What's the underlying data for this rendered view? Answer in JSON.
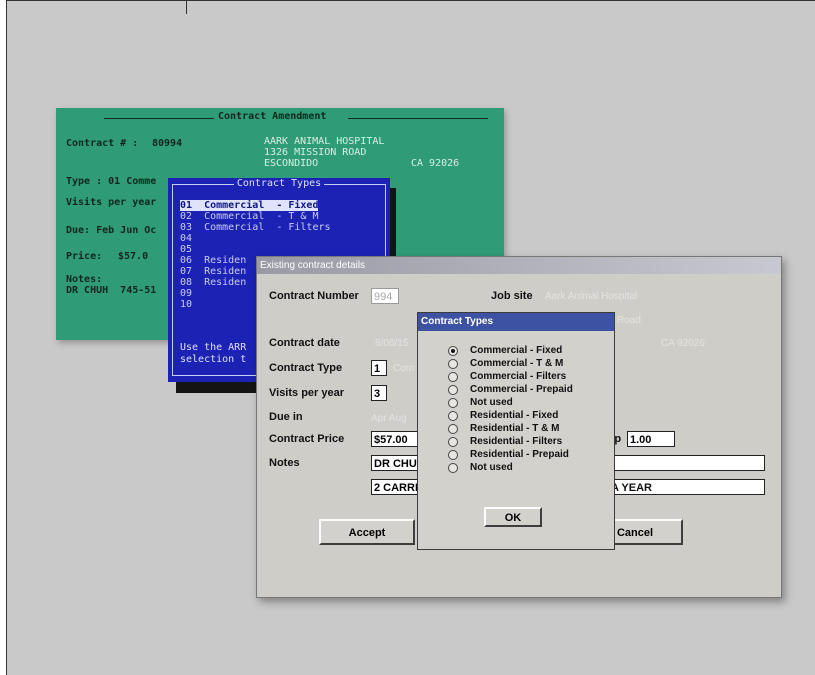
{
  "green_screen": {
    "title": "Contract Amendment",
    "contract_label": "Contract # :",
    "contract_number": "80994",
    "address1": "AARK ANIMAL HOSPITAL",
    "address2": "1326 MISSION ROAD",
    "city": "ESCONDIDO",
    "state_zip": "CA 92026",
    "type_label": "Type : 01 Comme",
    "visits_label": "Visits per year",
    "due_label": "Due: Feb Jun Oc",
    "price_label": "Price:",
    "price_value": "$57.0",
    "notes_label": "Notes:",
    "notes_value": "DR CHUH  745-51"
  },
  "blue_popup": {
    "title": "Contract Types",
    "rows": [
      "01  Commercial  - Fixed",
      "02  Commercial  - T & M",
      "03  Commercial  - Filters",
      "04",
      "05",
      "06  Residen",
      "07  Residen",
      "08  Residen",
      "09",
      "10"
    ],
    "hint1": "Use the ARR",
    "hint2": "selection t"
  },
  "dialog": {
    "title": "Existing contract details",
    "contract_number_label": "Contract Number",
    "contract_number_value": "994",
    "job_site_label": "Job site",
    "job_site_value": "Aark Animal Hospital",
    "road_value": "Road",
    "contract_date_label": "Contract date",
    "contract_date_value": "8/06/15",
    "state_zip_value": "CA  92026",
    "contract_type_label": "Contract Type",
    "contract_type_value": "1",
    "contract_type_ghost": "Com",
    "visits_label": "Visits per year",
    "visits_value": "3",
    "due_in_label": "Due in",
    "due_in_value": "Apr Aug",
    "contract_price_label": "Contract Price",
    "contract_price_value": "$57.00",
    "trip_label": "rip",
    "trip_value": "1.00",
    "notes_label": "Notes",
    "notes_line1": "DR CHU",
    "notes_line2": "2 CARRI",
    "notes_line2_tail": "A YEAR",
    "accept_label": "Accept",
    "cancel_label": "Cancel"
  },
  "modal": {
    "title": "Contract Types",
    "selected_index": 0,
    "options": [
      "Commercial  - Fixed",
      "Commercial  - T & M",
      "Commercial  - Filters",
      "Commercial  - Prepaid",
      "Not used",
      "Residential - Fixed",
      "Residential - T & M",
      "Residential - Filters",
      "Residential - Prepaid",
      "Not used"
    ],
    "ok_label": "OK"
  }
}
